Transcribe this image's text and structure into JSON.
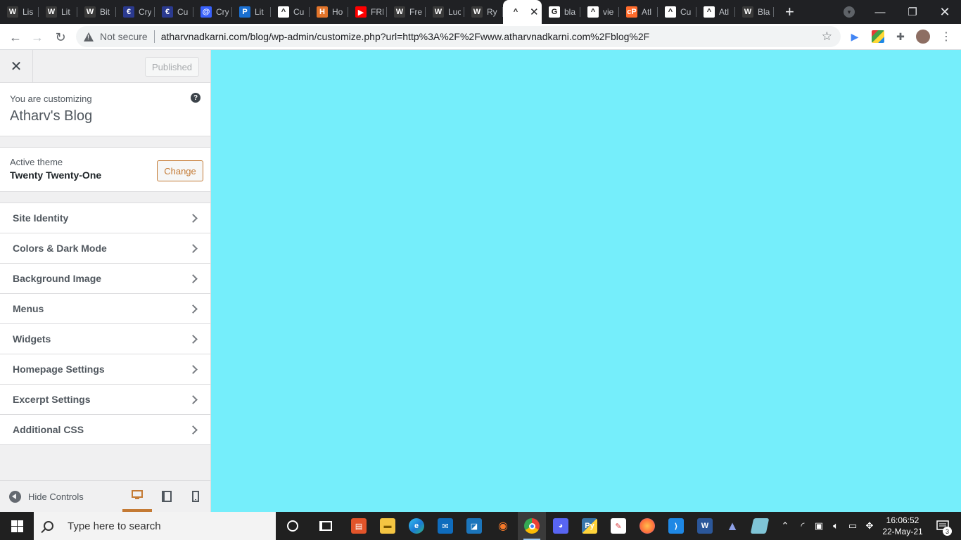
{
  "browser": {
    "tabs": [
      {
        "title": "Lis",
        "icon": "wordpress-icon",
        "color": "#3a3a3a",
        "glyph": "W"
      },
      {
        "title": "Lit",
        "icon": "wordpress-icon",
        "color": "#3a3a3a",
        "glyph": "W"
      },
      {
        "title": "Bit",
        "icon": "wordpress-icon",
        "color": "#3a3a3a",
        "glyph": "W"
      },
      {
        "title": "Cry",
        "icon": "crypto-icon",
        "color": "#2b3a8f",
        "glyph": "€"
      },
      {
        "title": "Cu",
        "icon": "crypto-icon",
        "color": "#2b3a8f",
        "glyph": "€"
      },
      {
        "title": "Cry",
        "icon": "coinmarket-icon",
        "color": "#3861fb",
        "glyph": "@"
      },
      {
        "title": "Lit",
        "icon": "liveproject-icon",
        "color": "#1a6fd1",
        "glyph": "P"
      },
      {
        "title": "Cu",
        "icon": "astra-icon",
        "color": "#ffffff",
        "glyph": "^"
      },
      {
        "title": "Ho",
        "icon": "hostinger-icon",
        "color": "#e2742a",
        "glyph": "H"
      },
      {
        "title": "FRI",
        "icon": "youtube-icon",
        "color": "#ff0000",
        "glyph": "▶"
      },
      {
        "title": "Fre",
        "icon": "wordpress-icon",
        "color": "#3a3a3a",
        "glyph": "W"
      },
      {
        "title": "Luc",
        "icon": "wordpress-icon",
        "color": "#3a3a3a",
        "glyph": "W"
      },
      {
        "title": "Ry",
        "icon": "wordpress-icon",
        "color": "#3a3a3a",
        "glyph": "W"
      },
      {
        "title": "",
        "icon": "astra-icon",
        "color": "#ffffff",
        "glyph": "^",
        "active": true
      },
      {
        "title": "bla",
        "icon": "google-icon",
        "color": "#ffffff",
        "glyph": "G"
      },
      {
        "title": "vie",
        "icon": "astra-icon",
        "color": "#ffffff",
        "glyph": "^"
      },
      {
        "title": "Atl",
        "icon": "cpanel-icon",
        "color": "#ff6c2c",
        "glyph": "cP"
      },
      {
        "title": "Cu",
        "icon": "astra-icon",
        "color": "#ffffff",
        "glyph": "^"
      },
      {
        "title": "Atl",
        "icon": "astra-icon",
        "color": "#ffffff",
        "glyph": "^"
      },
      {
        "title": "Bla",
        "icon": "wordpress-icon",
        "color": "#3a3a3a",
        "glyph": "W"
      }
    ],
    "not_secure": "Not secure",
    "url": "atharvnadkarni.com/blog/wp-admin/customize.php?url=http%3A%2F%2Fwww.atharvnadkarni.com%2Fblog%2F"
  },
  "customizer": {
    "published_label": "Published",
    "customizing_label": "You are customizing",
    "site_title": "Atharv's Blog",
    "active_theme_label": "Active theme",
    "theme_name": "Twenty Twenty-One",
    "change_label": "Change",
    "sections": [
      "Site Identity",
      "Colors & Dark Mode",
      "Background Image",
      "Menus",
      "Widgets",
      "Homepage Settings",
      "Excerpt Settings",
      "Additional CSS"
    ],
    "hide_controls_label": "Hide Controls"
  },
  "preview": {
    "background_color": "#75eefb"
  },
  "taskbar": {
    "search_placeholder": "Type here to search",
    "time": "16:06:52",
    "date": "22-May-21",
    "notification_count": "3"
  }
}
